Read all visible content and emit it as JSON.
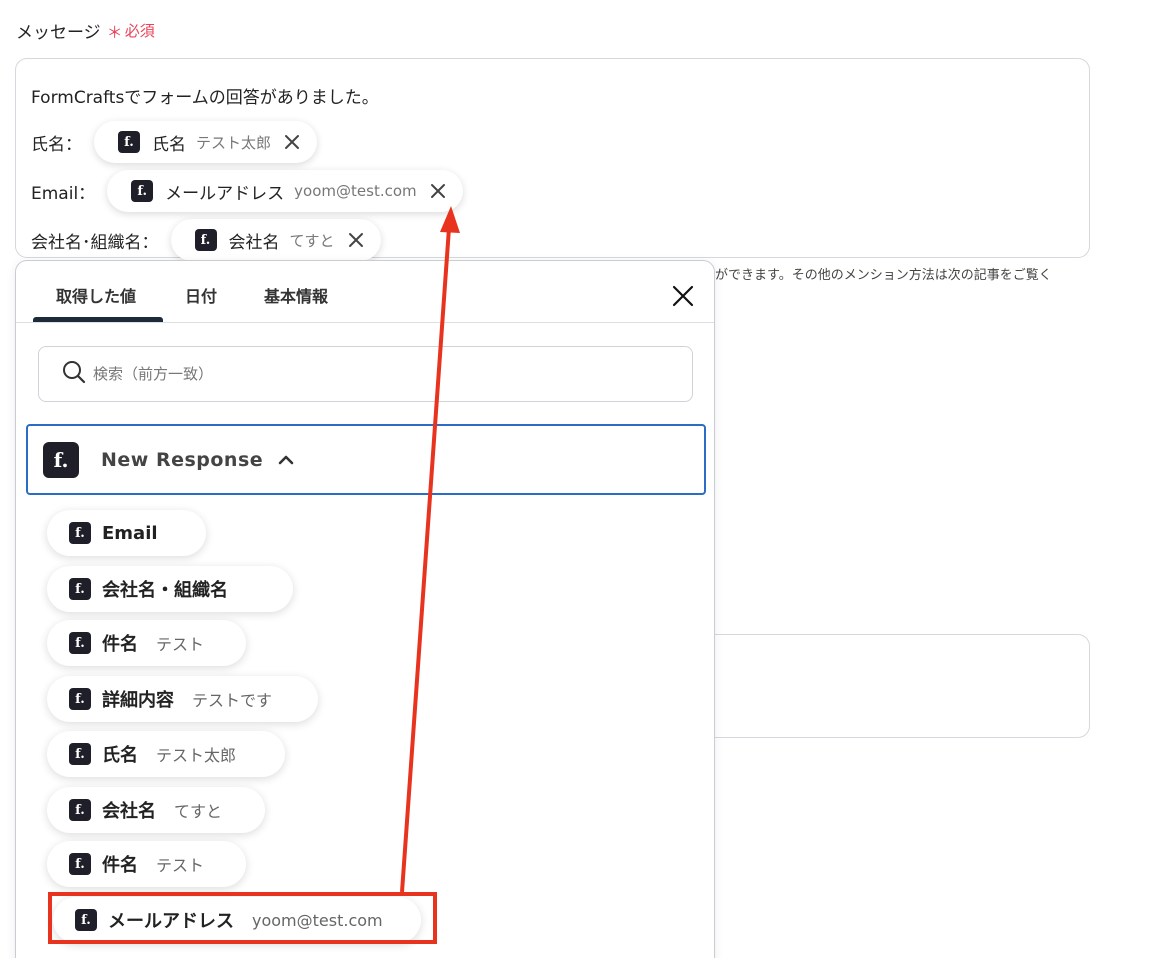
{
  "field": {
    "label": "メッセージ",
    "required_star": "＊",
    "required_text": "必須"
  },
  "message": {
    "intro": "FormCraftsでフォームの回答がありました。",
    "rows": [
      {
        "label": "氏名：",
        "chip_name": "氏名",
        "chip_value": "テスト太郎"
      },
      {
        "label": "Email：",
        "chip_name": "メールアドレス",
        "chip_value": "yoom@test.com"
      },
      {
        "label": "会社名･組織名：",
        "chip_name": "会社名",
        "chip_value": "てすと"
      }
    ]
  },
  "helper_text": "ができます。その他のメンション方法は次の記事をご覧く",
  "panel": {
    "tabs": [
      "取得した値",
      "日付",
      "基本情報"
    ],
    "active_tab": "取得した値",
    "search_placeholder": "検索（前方一致）",
    "accordion_title": "New Response",
    "items": [
      {
        "name": "Email",
        "value": ""
      },
      {
        "name": "会社名・組織名",
        "value": ""
      },
      {
        "name": "件名",
        "value": "テスト"
      },
      {
        "name": "詳細内容",
        "value": "テストです"
      },
      {
        "name": " 氏名",
        "value": "テスト太郎"
      },
      {
        "name": "会社名",
        "value": "てすと"
      },
      {
        "name": "件名",
        "value": "テスト"
      },
      {
        "name": "メールアドレス",
        "value": "yoom@test.com"
      }
    ]
  },
  "logo_letter": "f.",
  "icons": {
    "close": "close-icon",
    "search": "search-icon",
    "chevron": "chevron-up-icon",
    "logo": "formcrafts-logo-icon"
  },
  "colors": {
    "required": "#e8445a",
    "highlight": "#e8331f",
    "accordion_border": "#2b6cc4",
    "logo_bg": "#1f1f2a"
  }
}
